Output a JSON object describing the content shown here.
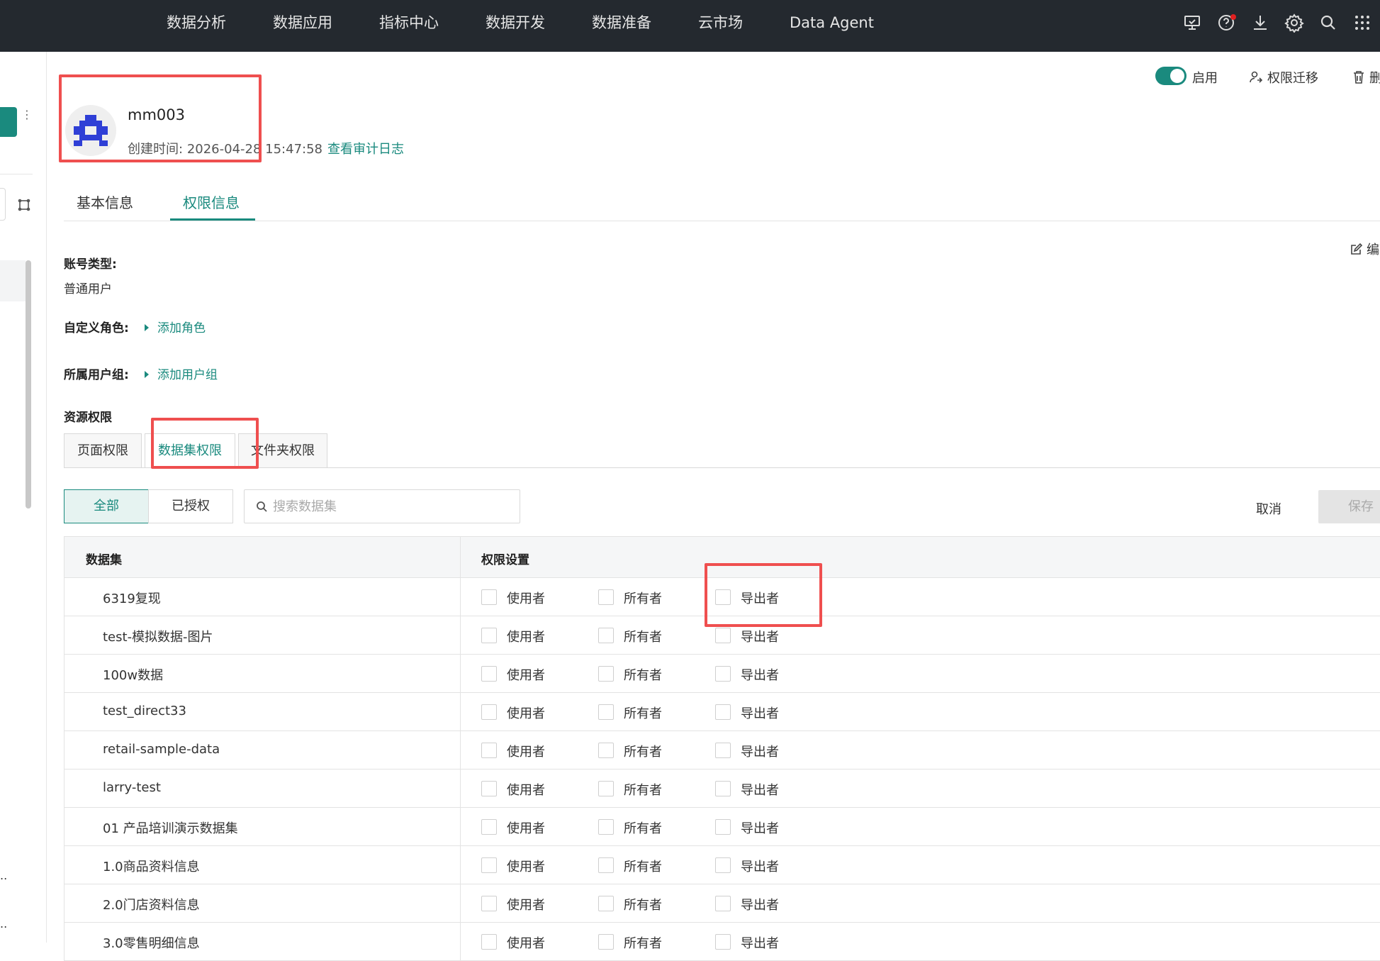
{
  "topnav": {
    "items": [
      "数据分析",
      "数据应用",
      "指标中心",
      "数据开发",
      "数据准备",
      "云市场",
      "Data Agent"
    ]
  },
  "topicons": [
    "monitor-icon",
    "help-icon",
    "download-icon",
    "settings-icon",
    "search-icon",
    "apps-grid-icon"
  ],
  "user": {
    "name": "mm003",
    "created_label": "创建时间:",
    "created_value": "2026-04-28 15:47:58",
    "audit_link": "查看审计日志"
  },
  "header_actions": {
    "toggle_label": "启用",
    "toggle_on": true,
    "transfer_label": "权限迁移",
    "delete_label": "删除",
    "edit_label": "编辑"
  },
  "tabs": [
    {
      "label": "基本信息",
      "active": false
    },
    {
      "label": "权限信息",
      "active": true
    }
  ],
  "account": {
    "type_label": "账号类型:",
    "type_value": "普通用户",
    "role_label": "自定义角色:",
    "role_link": "添加角色",
    "group_label": "所属用户组:",
    "group_link": "添加用户组",
    "resource_label": "资源权限"
  },
  "resource_tabs": [
    {
      "label": "页面权限",
      "active": false
    },
    {
      "label": "数据集权限",
      "active": true
    },
    {
      "label": "文件夹权限",
      "active": false
    }
  ],
  "filter": {
    "all_label": "全部",
    "granted_label": "已授权",
    "search_placeholder": "搜索数据集",
    "cancel_label": "取消",
    "save_label": "保存"
  },
  "table": {
    "col_dataset": "数据集",
    "col_perm": "权限设置",
    "perm_labels": [
      "使用者",
      "所有者",
      "导出者"
    ],
    "rows": [
      {
        "name": "6319复现",
        "user": false,
        "owner": false,
        "exporter": false
      },
      {
        "name": "test-模拟数据-图片",
        "user": false,
        "owner": false,
        "exporter": false
      },
      {
        "name": "100w数据",
        "user": false,
        "owner": false,
        "exporter": false
      },
      {
        "name": "test_direct33",
        "user": false,
        "owner": false,
        "exporter": false
      },
      {
        "name": "retail-sample-data",
        "user": false,
        "owner": false,
        "exporter": false
      },
      {
        "name": "larry-test",
        "user": false,
        "owner": false,
        "exporter": false
      },
      {
        "name": "01 产品培训演示数据集",
        "user": false,
        "owner": false,
        "exporter": false
      },
      {
        "name": "1.0商品资料信息",
        "user": false,
        "owner": false,
        "exporter": false
      },
      {
        "name": "2.0门店资料信息",
        "user": false,
        "owner": false,
        "exporter": false
      },
      {
        "name": "3.0零售明细信息",
        "user": false,
        "owner": false,
        "exporter": false
      }
    ]
  },
  "colors": {
    "accent": "#1a8a7e",
    "topbar": "#24292f",
    "highlight": "#ef4f4f"
  }
}
